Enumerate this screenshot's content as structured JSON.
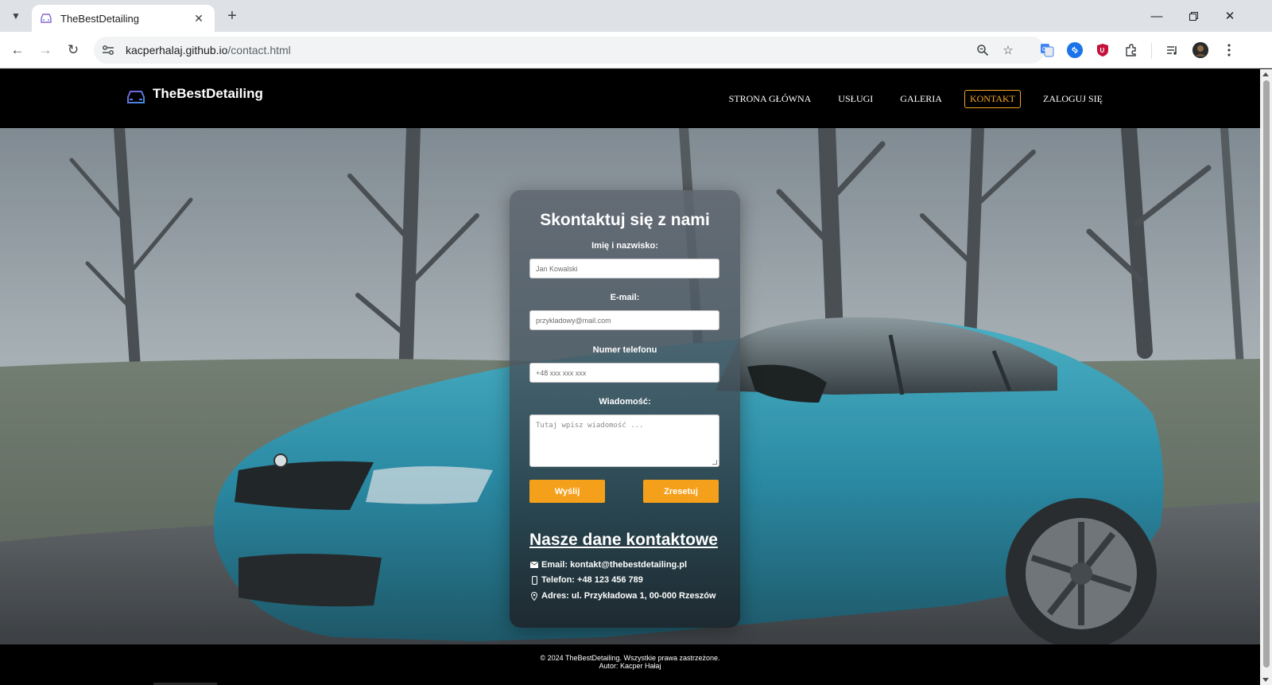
{
  "browser": {
    "tab_title": "TheBestDetailing",
    "url_host": "kacperhalaj.github.io",
    "url_path": "/contact.html"
  },
  "site": {
    "brand": "TheBestDetailing",
    "nav": [
      {
        "label": "STRONA GŁÓWNA",
        "active": false
      },
      {
        "label": "USŁUGI",
        "active": false
      },
      {
        "label": "GALERIA",
        "active": false
      },
      {
        "label": "KONTAKT",
        "active": true
      },
      {
        "label": "ZALOGUJ SIĘ",
        "active": false
      }
    ],
    "accent_color": "#f5a01a"
  },
  "form": {
    "title": "Skontaktuj się z nami",
    "name_label": "Imię i nazwisko:",
    "name_placeholder": "Jan Kowalski",
    "email_label": "E-mail:",
    "email_placeholder": "przykladowy@mail.com",
    "phone_label": "Numer telefonu",
    "phone_placeholder": "+48 xxx xxx xxx",
    "message_label": "Wiadomość:",
    "message_placeholder": "Tutaj wpisz wiadomość ...",
    "submit_label": "Wyślij",
    "reset_label": "Zresetuj"
  },
  "contact": {
    "title": "Nasze dane kontaktowe",
    "email": "Email: kontakt@thebestdetailing.pl",
    "phone": "Telefon: +48 123 456 789",
    "address": "Adres: ul. Przykładowa 1, 00-000 Rzeszów"
  },
  "footer": {
    "line1": "© 2024 TheBestDetailing. Wszystkie prawa zastrzeżone.",
    "line2": "Autor: Kacper Hałaj"
  }
}
